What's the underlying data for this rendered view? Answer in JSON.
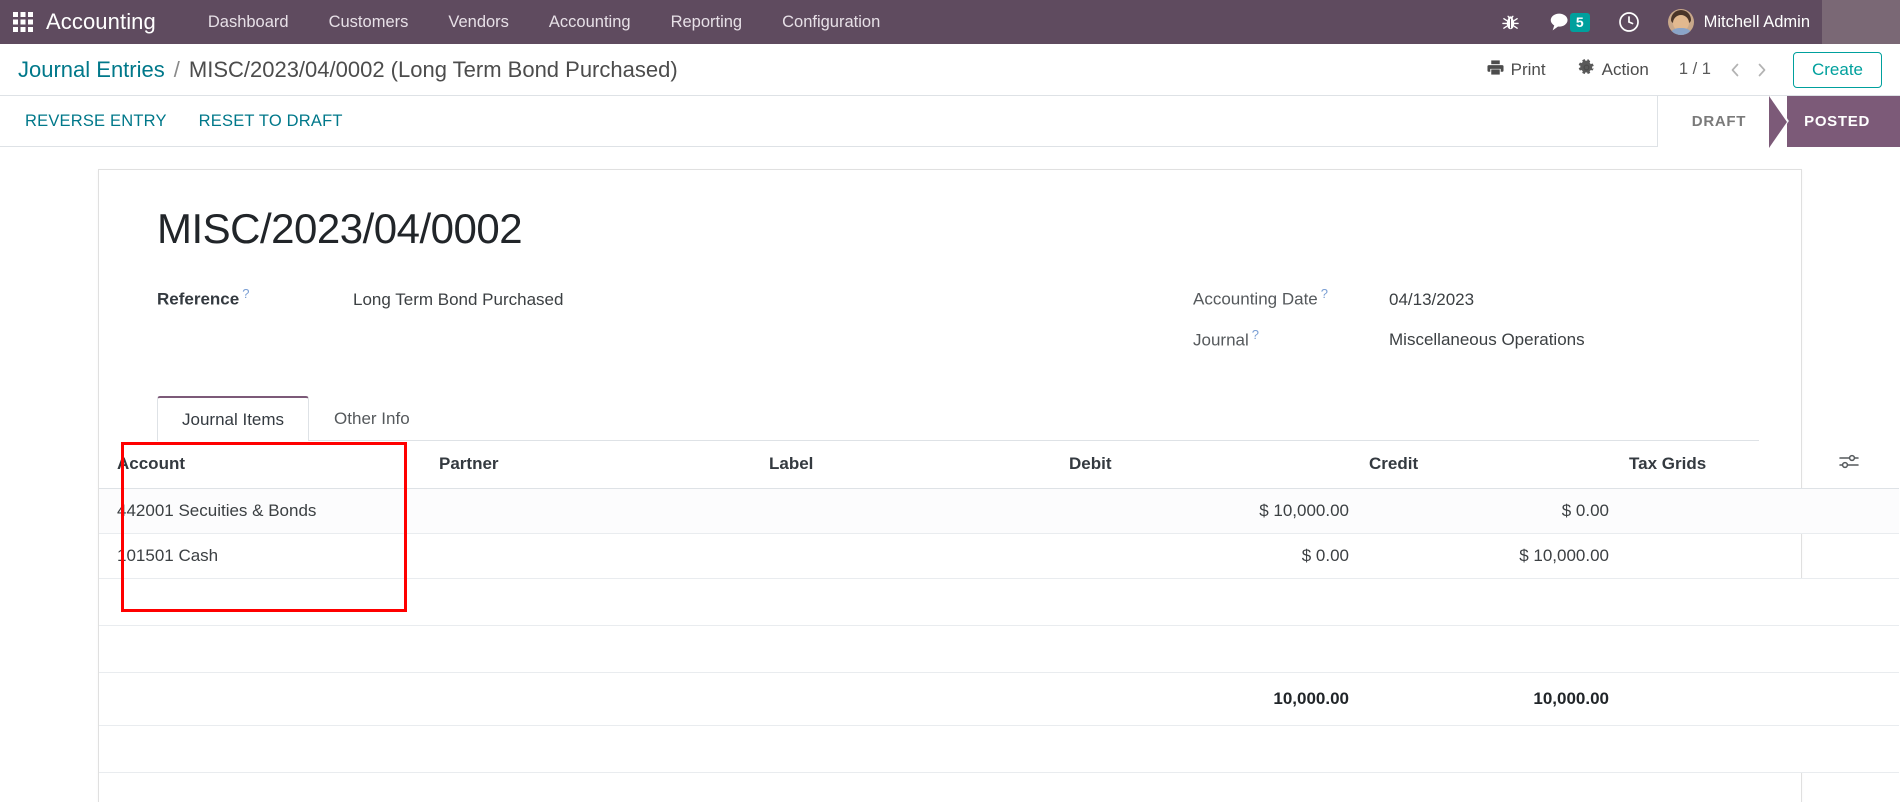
{
  "navbar": {
    "apps_icon": "apps-grid-icon",
    "brand": "Accounting",
    "menu": [
      {
        "label": "Dashboard"
      },
      {
        "label": "Customers"
      },
      {
        "label": "Vendors"
      },
      {
        "label": "Accounting"
      },
      {
        "label": "Reporting"
      },
      {
        "label": "Configuration"
      }
    ],
    "debug_icon": "bug-icon",
    "messages_icon": "chat-bubble-icon",
    "messages_count": "5",
    "activity_icon": "clock-icon",
    "user_name": "Mitchell Admin",
    "avatar_icon": "user-avatar"
  },
  "control_panel": {
    "breadcrumb_root": "Journal Entries",
    "breadcrumb_separator": "/",
    "breadcrumb_current": "MISC/2023/04/0002 (Long Term Bond Purchased)",
    "print_label": "Print",
    "print_icon": "printer-icon",
    "action_label": "Action",
    "action_icon": "gear-icon",
    "pager": "1 / 1",
    "pager_prev_icon": "chevron-left-icon",
    "pager_next_icon": "chevron-right-icon",
    "create_label": "Create"
  },
  "statusbar": {
    "buttons": [
      {
        "label": "REVERSE ENTRY"
      },
      {
        "label": "RESET TO DRAFT"
      }
    ],
    "stages": [
      {
        "label": "DRAFT",
        "active": false
      },
      {
        "label": "POSTED",
        "active": true
      }
    ]
  },
  "record": {
    "title": "MISC/2023/04/0002",
    "fields_left": [
      {
        "label": "Reference",
        "help": "?",
        "value": "Long Term Bond Purchased"
      }
    ],
    "fields_right": [
      {
        "label": "Accounting Date",
        "help": "?",
        "value": "04/13/2023"
      },
      {
        "label": "Journal",
        "help": "?",
        "value": "Miscellaneous Operations"
      }
    ]
  },
  "notebook": {
    "tabs": [
      {
        "label": "Journal Items",
        "active": true
      },
      {
        "label": "Other Info",
        "active": false
      }
    ]
  },
  "lines_table": {
    "columns": [
      "Account",
      "Partner",
      "Label",
      "Debit",
      "Credit",
      "Tax Grids"
    ],
    "optional_columns_icon": "column-options-icon",
    "rows": [
      {
        "account": "442001 Secuities & Bonds",
        "partner": "",
        "label": "",
        "debit": "$ 10,000.00",
        "credit": "$ 0.00",
        "tax_grids": ""
      },
      {
        "account": "101501 Cash",
        "partner": "",
        "label": "",
        "debit": "$ 0.00",
        "credit": "$ 10,000.00",
        "tax_grids": ""
      }
    ],
    "totals": {
      "debit": "10,000.00",
      "credit": "10,000.00"
    }
  },
  "annotation": {
    "highlight_color": "#ff0000",
    "target": "account-column"
  },
  "colors": {
    "navbar_bg": "#5f4b5f",
    "accent_teal": "#00a09d",
    "link_teal": "#00788a",
    "stage_active": "#7c5a78",
    "badge_bg": "#00a09d"
  }
}
